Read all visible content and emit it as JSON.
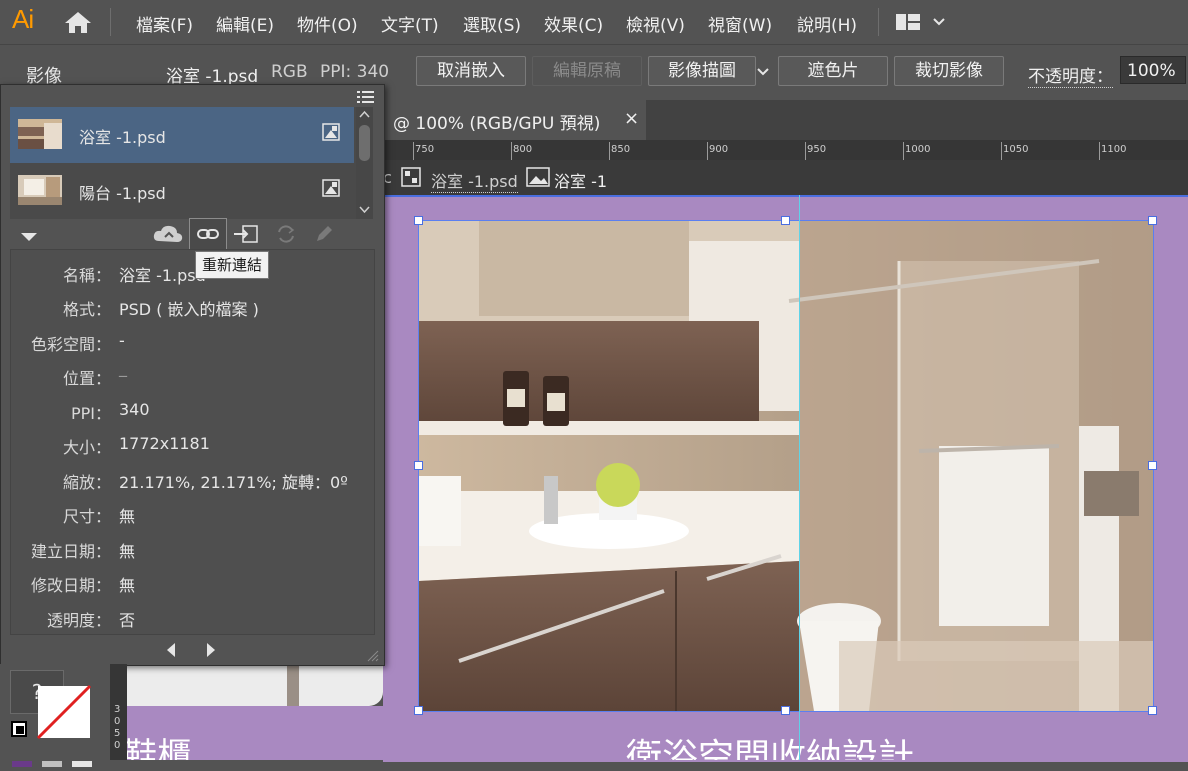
{
  "app": {
    "logo": "Ai"
  },
  "menu": [
    "檔案(F)",
    "編輯(E)",
    "物件(O)",
    "文字(T)",
    "選取(S)",
    "效果(C)",
    "檢視(V)",
    "視窗(W)",
    "說明(H)"
  ],
  "control": {
    "title": "影像",
    "file": "浴室 -1.psd",
    "mode": "RGB",
    "ppi": "PPI: 340",
    "unembed": "取消嵌入",
    "edit_original": "編輯原稿",
    "image_trace": "影像描圖",
    "mask": "遮色片",
    "crop": "裁切影像",
    "opacity_label": "不透明度：",
    "opacity_value": "100%"
  },
  "tab": {
    "title": "@ 100% (RGB/GPU 預視)",
    "close": "×"
  },
  "ruler": [
    "750",
    "800",
    "850",
    "900",
    "950",
    "1000",
    "1050",
    "1100"
  ],
  "vruler": [
    "3",
    "0",
    "5",
    "0"
  ],
  "breadcrumb": {
    "c": "c",
    "file": "浴室 -1.psd",
    "layer": "浴室 -1"
  },
  "links": [
    {
      "name": "浴室 -1.psd"
    },
    {
      "name": "陽台 -1.psd"
    }
  ],
  "tooltip": "重新連結",
  "info": {
    "name_label": "名稱：",
    "name_value": "浴室 -1.psd",
    "format_label": "格式：",
    "format_value": "PSD ( 嵌入的檔案 )",
    "colorspace_label": "色彩空間：",
    "colorspace_value": "-",
    "location_label": "位置：",
    "location_value": "_",
    "ppi_label": "PPI：",
    "ppi_value": "340",
    "size_label": "大小：",
    "size_value": "1772x1181",
    "scale_label": "縮放：",
    "scale_value": "21.171%, 21.171%; 旋轉：0º",
    "dimension_label": "尺寸：",
    "dimension_value": "無",
    "created_label": "建立日期：",
    "created_value": "無",
    "modified_label": "修改日期：",
    "modified_value": "無",
    "transparency_label": "透明度：",
    "transparency_value": "否"
  },
  "canvas": {
    "left_text": "]鞋櫃",
    "right_text": "衛浴空間收納設計"
  },
  "tools": {
    "help": "?"
  },
  "colors": {
    "accent": "#4a6ee0",
    "artboard": "#a989c1",
    "logo": "#ff9a00",
    "selected_row": "#4b6584"
  }
}
